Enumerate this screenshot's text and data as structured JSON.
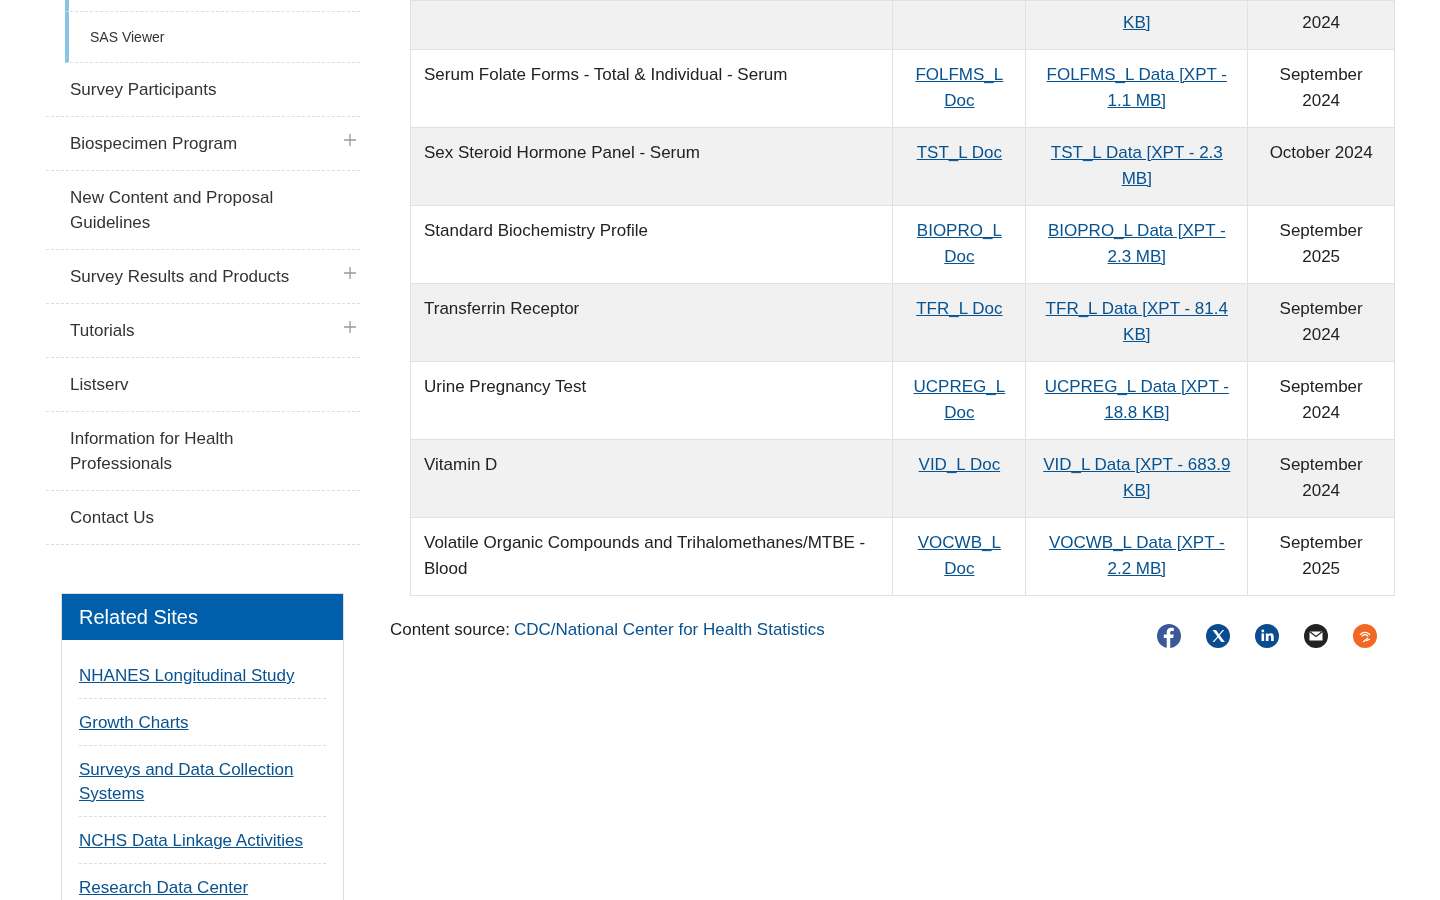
{
  "sidebar": {
    "items": [
      {
        "label": "SAS Viewer",
        "kind": "sub"
      },
      {
        "label": "Survey Participants",
        "kind": "main"
      },
      {
        "label": "Biospecimen Program",
        "kind": "main",
        "expandable": true
      },
      {
        "label": "New Content and Proposal Guidelines",
        "kind": "main"
      },
      {
        "label": "Survey Results and Products",
        "kind": "main",
        "expandable": true
      },
      {
        "label": "Tutorials",
        "kind": "main",
        "expandable": true
      },
      {
        "label": "Listserv",
        "kind": "main"
      },
      {
        "label": "Information for Health Professionals",
        "kind": "main"
      },
      {
        "label": "Contact Us",
        "kind": "main"
      }
    ]
  },
  "related_sites": {
    "title": "Related Sites",
    "links": [
      "NHANES Longitudinal Study",
      "Growth Charts",
      "Surveys and Data Collection Systems",
      "NCHS Data Linkage Activities",
      "Research Data Center"
    ]
  },
  "table": {
    "rows": [
      {
        "data_link": "KB]",
        "release": "2024"
      },
      {
        "name": "Serum Folate Forms - Total & Individual - Serum",
        "doc_link": "FOLFMS_L Doc",
        "data_link": "FOLFMS_L Data [XPT - 1.1 MB]",
        "release": "September 2024"
      },
      {
        "name": "Sex Steroid Hormone Panel - Serum",
        "doc_link": "TST_L Doc",
        "data_link": "TST_L Data [XPT - 2.3 MB]",
        "release": "October 2024"
      },
      {
        "name": "Standard Biochemistry Profile",
        "doc_link": "BIOPRO_L Doc",
        "data_link": "BIOPRO_L Data [XPT - 2.3 MB]",
        "release": "September 2025"
      },
      {
        "name": "Transferrin Receptor",
        "doc_link": "TFR_L Doc",
        "data_link": "TFR_L Data [XPT - 81.4 KB]",
        "release": "September 2024"
      },
      {
        "name": "Urine Pregnancy Test",
        "doc_link": "UCPREG_L Doc",
        "data_link": "UCPREG_L Data [XPT - 18.8 KB]",
        "release": "September 2024"
      },
      {
        "name": "Vitamin D",
        "doc_link": "VID_L Doc",
        "data_link": "VID_L Data [XPT - 683.9 KB]",
        "release": "September 2024"
      },
      {
        "name": "Volatile Organic Compounds and Trihalomethanes/MTBE - Blood",
        "doc_link": "VOCWB_L Doc",
        "data_link": "VOCWB_L Data [XPT - 2.2 MB]",
        "release": "September 2025"
      }
    ]
  },
  "content_source": {
    "label": "Content source:",
    "link": "CDC/National Center for Health Statistics"
  },
  "share": [
    {
      "kind": "facebook",
      "color": "#3b5998"
    },
    {
      "kind": "x",
      "color": "#0a4c8f"
    },
    {
      "kind": "linkedin",
      "color": "#0a4c8f"
    },
    {
      "kind": "email",
      "color": "#222222"
    },
    {
      "kind": "syndicate",
      "color": "#f26722"
    }
  ]
}
